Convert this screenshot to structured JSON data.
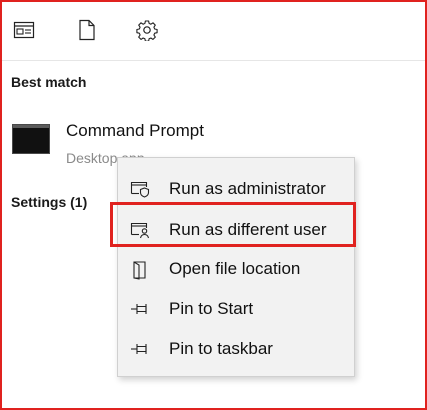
{
  "toolbar": {
    "icons": [
      "apps-icon",
      "document-icon",
      "settings-gear-icon"
    ]
  },
  "best_match": {
    "title": "Best match",
    "item": {
      "name": "Command Prompt",
      "subtitle": "Desktop app",
      "icon": "command-prompt-icon"
    }
  },
  "settings": {
    "title": "Settings (1)"
  },
  "context_menu": {
    "items": [
      {
        "label": "Run as administrator",
        "icon": "shield-window-icon"
      },
      {
        "label": "Run as different user",
        "icon": "user-window-icon",
        "highlighted": true
      },
      {
        "label": "Open file location",
        "icon": "folder-location-icon"
      },
      {
        "label": "Pin to Start",
        "icon": "pin-icon"
      },
      {
        "label": "Pin to taskbar",
        "icon": "pin-icon"
      }
    ]
  },
  "colors": {
    "highlight_border": "#e0221f",
    "menu_background": "#f2f2f2"
  }
}
